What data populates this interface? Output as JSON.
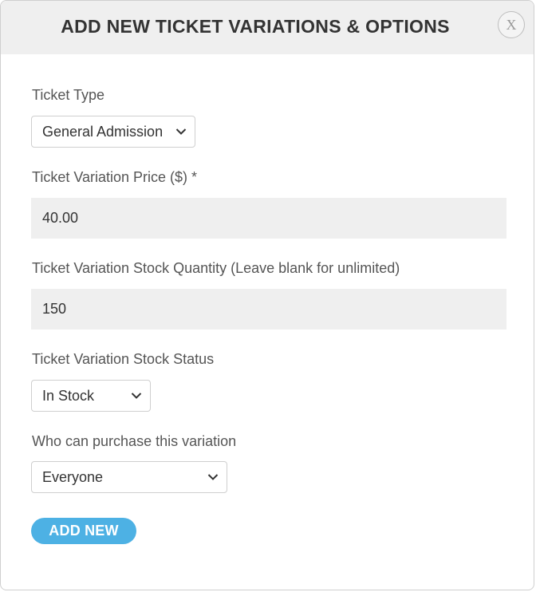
{
  "dialog": {
    "title": "ADD NEW TICKET VARIATIONS & OPTIONS",
    "close_label": "X"
  },
  "form": {
    "ticket_type": {
      "label": "Ticket Type",
      "value": "General Admission"
    },
    "price": {
      "label": "Ticket Variation Price ($) *",
      "value": "40.00"
    },
    "stock_quantity": {
      "label": "Ticket Variation Stock Quantity (Leave blank for unlimited)",
      "value": "150"
    },
    "stock_status": {
      "label": "Ticket Variation Stock Status",
      "value": "In Stock"
    },
    "who_can_purchase": {
      "label": "Who can purchase this variation",
      "value": "Everyone"
    },
    "submit_label": "ADD NEW"
  },
  "colors": {
    "header_bg": "#efefef",
    "input_bg": "#efefef",
    "accent": "#4db1e4"
  }
}
